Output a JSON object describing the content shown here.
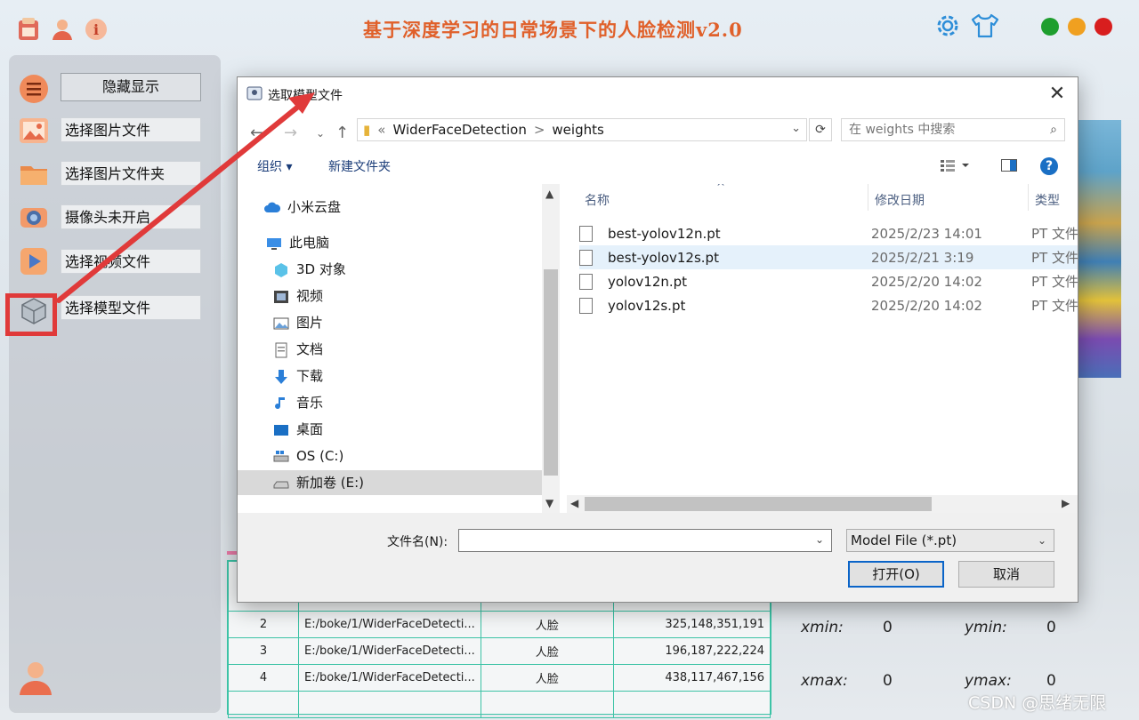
{
  "app": {
    "title": "基于深度学习的日常场景下的人脸检测v2.0",
    "colors": {
      "title": "#e0602a",
      "close": "#d81e1e",
      "maximize": "#f0a020",
      "minimize": "#1e9e2e",
      "highlight": "#e03a3a",
      "table_border": "#3cc3a6"
    }
  },
  "sidebar": {
    "hide_label": "隐藏显示",
    "items": [
      {
        "label": "选择图片文件",
        "icon": "image-icon"
      },
      {
        "label": "选择图片文件夹",
        "icon": "folder-icon"
      },
      {
        "label": "摄像头未开启",
        "icon": "camera-icon"
      },
      {
        "label": "选择视频文件",
        "icon": "video-play-icon"
      },
      {
        "label": "选择模型文件",
        "icon": "model-cube-icon"
      }
    ]
  },
  "results_table": {
    "rows": [
      {
        "index": "2",
        "path": "E:/boke/1/WiderFaceDetecti...",
        "class": "人脸",
        "box": "325,148,351,191"
      },
      {
        "index": "3",
        "path": "E:/boke/1/WiderFaceDetecti...",
        "class": "人脸",
        "box": "196,187,222,224"
      },
      {
        "index": "4",
        "path": "E:/boke/1/WiderFaceDetecti...",
        "class": "人脸",
        "box": "438,117,467,156"
      }
    ]
  },
  "coords": {
    "xmin_label": "xmin:",
    "xmin_value": "0",
    "ymin_label": "ymin:",
    "ymin_value": "0",
    "xmax_label": "xmax:",
    "xmax_value": "0",
    "ymax_label": "ymax:",
    "ymax_value": "0"
  },
  "watermark": "CSDN @思绪无限",
  "dialog": {
    "title": "选取模型文件",
    "address": {
      "prefix": "«",
      "part1": "WiderFaceDetection",
      "sep": ">",
      "part2": "weights"
    },
    "search_placeholder": "在 weights 中搜索",
    "toolbar": {
      "organize": "组织 ▾",
      "new_folder": "新建文件夹",
      "help": "?"
    },
    "tree": [
      {
        "label": "小米云盘",
        "icon": "cloud-icon"
      },
      {
        "label": "此电脑",
        "icon": "computer-icon"
      },
      {
        "label": "3D 对象",
        "icon": "3d-objects-icon"
      },
      {
        "label": "视频",
        "icon": "videos-icon"
      },
      {
        "label": "图片",
        "icon": "pictures-icon"
      },
      {
        "label": "文档",
        "icon": "documents-icon"
      },
      {
        "label": "下载",
        "icon": "download-icon"
      },
      {
        "label": "音乐",
        "icon": "music-icon"
      },
      {
        "label": "桌面",
        "icon": "desktop-icon"
      },
      {
        "label": "OS (C:)",
        "icon": "drive-c-icon"
      },
      {
        "label": "新加卷 (E:)",
        "icon": "drive-e-icon"
      }
    ],
    "columns": {
      "name": "名称",
      "date": "修改日期",
      "type": "类型"
    },
    "files": [
      {
        "name": "best-yolov12n.pt",
        "date": "2025/2/23 14:01",
        "type": "PT 文件"
      },
      {
        "name": "best-yolov12s.pt",
        "date": "2025/2/21 3:19",
        "type": "PT 文件"
      },
      {
        "name": "yolov12n.pt",
        "date": "2025/2/20 14:02",
        "type": "PT 文件"
      },
      {
        "name": "yolov12s.pt",
        "date": "2025/2/20 14:02",
        "type": "PT 文件"
      }
    ],
    "filename_label": "文件名(N):",
    "filename_value": "",
    "filetype": "Model File (*.pt)",
    "open_button": "打开(O)",
    "cancel_button": "取消"
  }
}
